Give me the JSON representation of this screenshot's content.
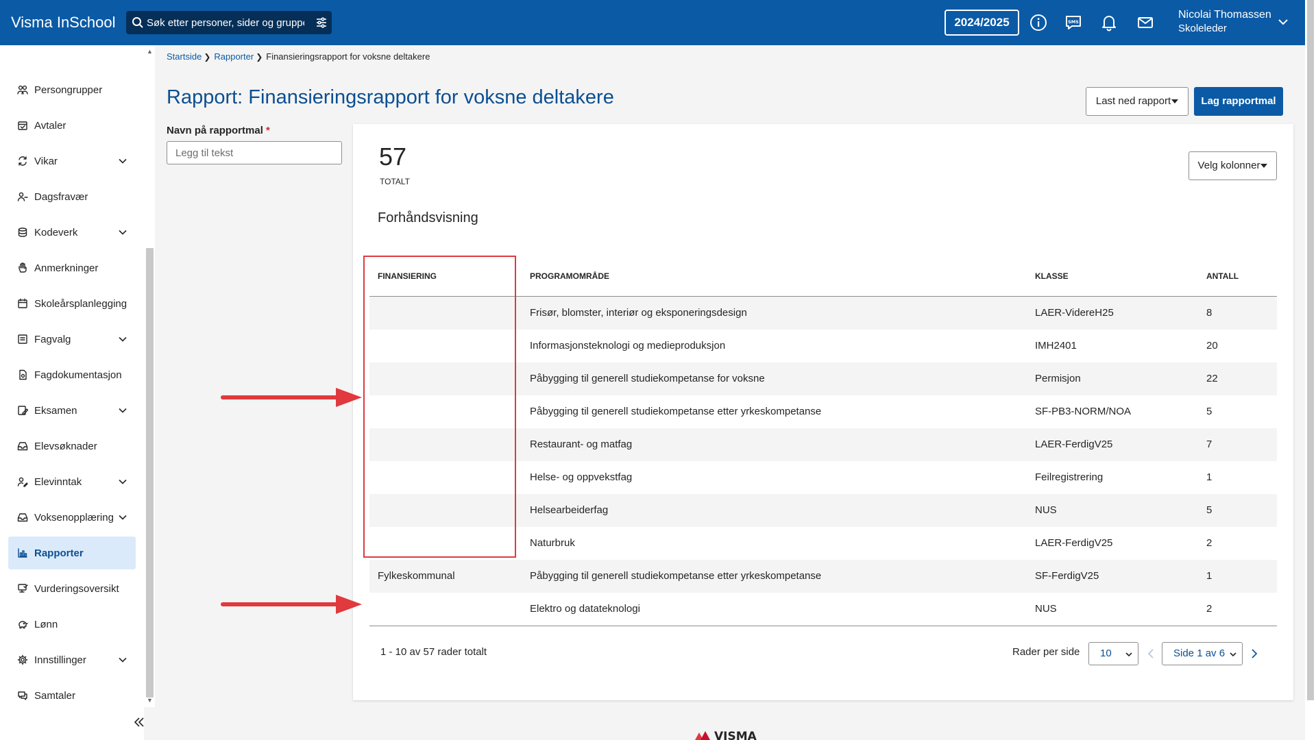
{
  "app": {
    "title": "Visma InSchool"
  },
  "search": {
    "placeholder": "Søk etter personer, sider og grupper"
  },
  "header": {
    "school_year": "2024/2025",
    "user_name": "Nicolai Thomassen",
    "user_role": "Skoleleder",
    "icons": [
      "info-icon",
      "sms-icon",
      "bell-icon",
      "mail-icon",
      "chevron-down-icon"
    ]
  },
  "colors": {
    "brand": "#0b5aa6",
    "title": "#0b4f92",
    "active_bg": "#dbeafa",
    "annotation": "#e0393e"
  },
  "sidebar": {
    "items": [
      {
        "label": "Persongrupper",
        "icon": "people-icon",
        "expandable": false
      },
      {
        "label": "Avtaler",
        "icon": "calendar-check-icon",
        "expandable": false
      },
      {
        "label": "Vikar",
        "icon": "swap-icon",
        "expandable": true
      },
      {
        "label": "Dagsfravær",
        "icon": "person-absent-icon",
        "expandable": false
      },
      {
        "label": "Kodeverk",
        "icon": "database-icon",
        "expandable": true
      },
      {
        "label": "Anmerkninger",
        "icon": "hand-icon",
        "expandable": false
      },
      {
        "label": "Skoleårsplanlegging",
        "icon": "calendar-icon",
        "expandable": false
      },
      {
        "label": "Fagvalg",
        "icon": "list-box-icon",
        "expandable": true
      },
      {
        "label": "Fagdokumentasjon",
        "icon": "document-gear-icon",
        "expandable": false
      },
      {
        "label": "Eksamen",
        "icon": "exam-edit-icon",
        "expandable": true
      },
      {
        "label": "Elevsøknader",
        "icon": "inbox-icon",
        "expandable": false
      },
      {
        "label": "Elevinntak",
        "icon": "person-edit-icon",
        "expandable": true
      },
      {
        "label": "Voksenopplæring",
        "icon": "inbox-icon",
        "expandable": true
      },
      {
        "label": "Rapporter",
        "icon": "bar-chart-icon",
        "expandable": false,
        "active": true
      },
      {
        "label": "Vurderingsoversikt",
        "icon": "review-icon",
        "expandable": false
      },
      {
        "label": "Lønn",
        "icon": "piggy-bank-icon",
        "expandable": false
      },
      {
        "label": "Innstillinger",
        "icon": "gear-icon",
        "expandable": true
      },
      {
        "label": "Samtaler",
        "icon": "chat-icon",
        "expandable": false
      }
    ]
  },
  "breadcrumb": {
    "home": "Startside",
    "reports": "Rapporter",
    "current": "Finansieringsrapport for voksne deltakere"
  },
  "page": {
    "title": "Rapport: Finansieringsrapport for voksne deltakere",
    "download_label": "Last ned rapport",
    "create_template_label": "Lag rapportmal",
    "template_name_label": "Navn på rapportmal",
    "required_mark": "*",
    "template_name_placeholder": "Legg til tekst",
    "template_name_value": ""
  },
  "report": {
    "total": "57",
    "total_label": "TOTALT",
    "select_columns_label": "Velg kolonner",
    "preview_title": "Forhåndsvisning",
    "columns": [
      "FINANSIERING",
      "PROGRAMOMRÅDE",
      "KLASSE",
      "ANTALL"
    ],
    "rows": [
      {
        "finansiering": "",
        "programomrade": "Frisør, blomster, interiør og eksponeringsdesign",
        "klasse": "LAER-VidereH25",
        "antall": "8"
      },
      {
        "finansiering": "",
        "programomrade": "Informasjonsteknologi og medieproduksjon",
        "klasse": "IMH2401",
        "antall": "20"
      },
      {
        "finansiering": "",
        "programomrade": "Påbygging til generell studiekompetanse for voksne",
        "klasse": "Permisjon",
        "antall": "22"
      },
      {
        "finansiering": "",
        "programomrade": "Påbygging til generell studiekompetanse etter yrkeskompetanse",
        "klasse": "SF-PB3-NORM/NOA",
        "antall": "5"
      },
      {
        "finansiering": "",
        "programomrade": "Restaurant- og matfag",
        "klasse": "LAER-FerdigV25",
        "antall": "7"
      },
      {
        "finansiering": "",
        "programomrade": "Helse- og oppvekstfag",
        "klasse": "Feilregistrering",
        "antall": "1"
      },
      {
        "finansiering": "",
        "programomrade": "Helsearbeiderfag",
        "klasse": "NUS",
        "antall": "5"
      },
      {
        "finansiering": "",
        "programomrade": "Naturbruk",
        "klasse": "LAER-FerdigV25",
        "antall": "2"
      },
      {
        "finansiering": "Fylkeskommunal",
        "programomrade": "Påbygging til generell studiekompetanse etter yrkeskompetanse",
        "klasse": "SF-FerdigV25",
        "antall": "1"
      },
      {
        "finansiering": "",
        "programomrade": "Elektro og datateknologi",
        "klasse": "NUS",
        "antall": "2"
      }
    ],
    "pagination": {
      "info": "1 - 10 av 57 rader totalt",
      "rows_per_page_label": "Rader per side",
      "rows_per_page_value": "10",
      "page_value": "Side 1 av 6"
    }
  },
  "footer": {
    "logo_text": "VISMA"
  }
}
